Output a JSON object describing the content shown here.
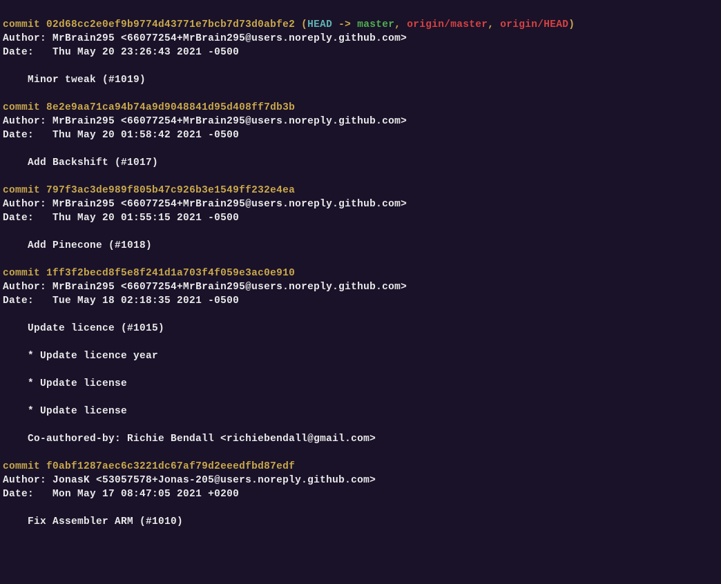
{
  "labels": {
    "commit": "commit",
    "author": "Author:",
    "date": "Date:"
  },
  "refs": {
    "head": "HEAD",
    "arrow": "->",
    "master": "master",
    "origin_master": "origin/master",
    "origin_head": "origin/HEAD"
  },
  "commits": [
    {
      "hash": "02d68cc2e0ef9b9774d43771e7bcb7d73d0abfe2",
      "refs": true,
      "author": "MrBrain295 <66077254+MrBrain295@users.noreply.github.com>",
      "date": "Thu May 20 23:26:43 2021 -0500",
      "message": [
        "Minor tweak (#1019)"
      ]
    },
    {
      "hash": "8e2e9aa71ca94b74a9d9048841d95d408ff7db3b",
      "refs": false,
      "author": "MrBrain295 <66077254+MrBrain295@users.noreply.github.com>",
      "date": "Thu May 20 01:58:42 2021 -0500",
      "message": [
        "Add Backshift (#1017)"
      ]
    },
    {
      "hash": "797f3ac3de989f805b47c926b3e1549ff232e4ea",
      "refs": false,
      "author": "MrBrain295 <66077254+MrBrain295@users.noreply.github.com>",
      "date": "Thu May 20 01:55:15 2021 -0500",
      "message": [
        "Add Pinecone (#1018)"
      ]
    },
    {
      "hash": "1ff3f2becd8f5e8f241d1a703f4f059e3ac0e910",
      "refs": false,
      "author": "MrBrain295 <66077254+MrBrain295@users.noreply.github.com>",
      "date": "Tue May 18 02:18:35 2021 -0500",
      "message": [
        "Update licence (#1015)",
        "",
        "* Update licence year",
        "",
        "* Update license",
        "",
        "* Update license",
        "",
        "Co-authored-by: Richie Bendall <richiebendall@gmail.com>"
      ]
    },
    {
      "hash": "f0abf1287aec6c3221dc67af79d2eeedfbd87edf",
      "refs": false,
      "author": "JonasK <53057578+Jonas-205@users.noreply.github.com>",
      "date": "Mon May 17 08:47:05 2021 +0200",
      "message": [
        "Fix Assembler ARM (#1010)"
      ]
    }
  ]
}
